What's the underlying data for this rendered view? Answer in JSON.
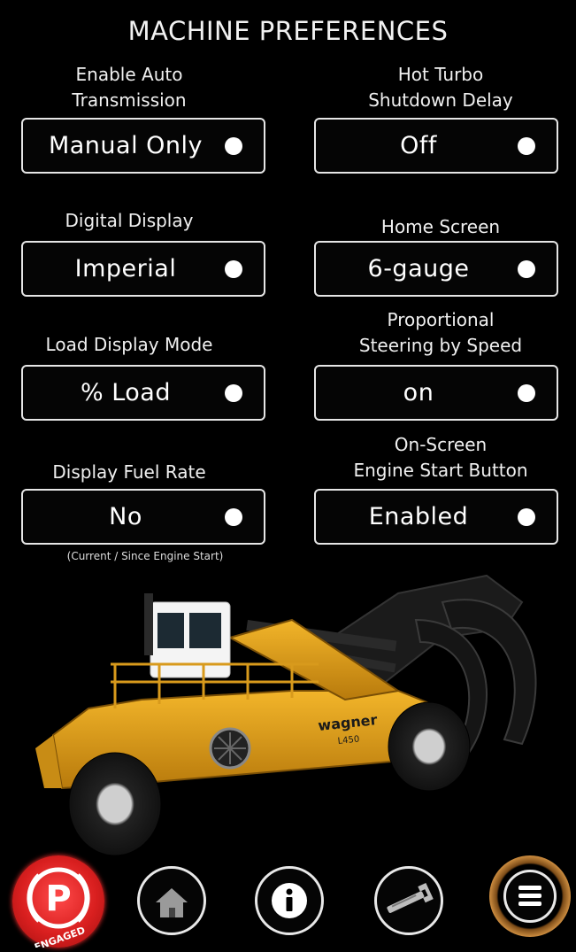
{
  "screen_title": "MACHINE PREFERENCES",
  "settings": {
    "auto_transmission": {
      "label_line1": "Enable Auto",
      "label_line2": "Transmission",
      "value": "Manual Only"
    },
    "hot_turbo": {
      "label_line1": "Hot Turbo",
      "label_line2": "Shutdown Delay",
      "value": "Off"
    },
    "digital_display": {
      "label": "Digital Display",
      "value": "Imperial"
    },
    "home_screen": {
      "label": "Home Screen",
      "value": "6-gauge"
    },
    "load_display": {
      "label": "Load Display Mode",
      "value": "% Load"
    },
    "proportional_steering": {
      "label_line1": "Proportional",
      "label_line2": "Steering by Speed",
      "value": "on"
    },
    "fuel_rate": {
      "label": "Display Fuel Rate",
      "value": "No",
      "note": "(Current / Since Engine Start)"
    },
    "engine_start": {
      "label_line1": "On-Screen",
      "label_line2": "Engine Start Button",
      "value": "Enabled"
    }
  },
  "machine": {
    "brand": "wagner",
    "model": "L450"
  },
  "nav": {
    "park_label": "ENGAGED",
    "park_letter": "P",
    "icons": [
      "parking-brake-icon",
      "home-icon",
      "info-icon",
      "wrench-icon",
      "menu-icon"
    ]
  },
  "colors": {
    "background": "#000000",
    "machine_yellow": "#e8a317",
    "park_red": "#d91f1f",
    "menu_ring": "#c98a3e"
  }
}
